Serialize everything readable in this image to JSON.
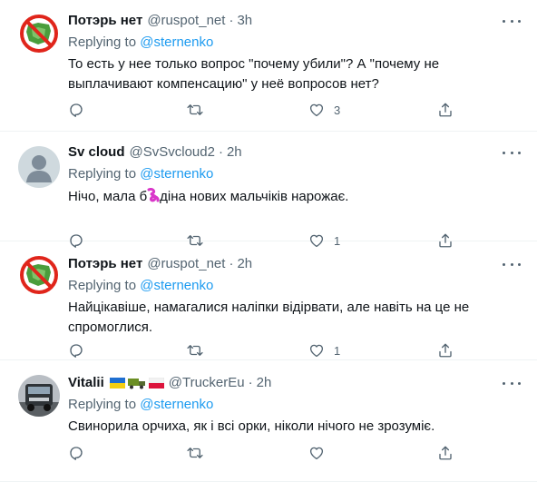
{
  "replying_prefix": "Replying to ",
  "colors": {
    "accent": "#1d9bf0",
    "muted": "#536471",
    "text": "#0f1419"
  },
  "tweets": [
    {
      "name": "Потэрь нет",
      "handle": "@ruspot_net",
      "dot": "·",
      "time": "3h",
      "replying_to": "@sternenko",
      "text": "То есть у нее только вопрос \"почему убили\"? А \"почему не выплачивают компенсацию\" у неё вопросов нет?",
      "likes": "3",
      "avatar_icon": "crossed-out-sign-avatar"
    },
    {
      "name": "Sv cloud",
      "handle": "@SvSvcloud2",
      "dot": "·",
      "time": "2h",
      "replying_to": "@sternenko",
      "text_before": "Нічо, мала б",
      "text_after": "діна нових мальчіків нарожає.",
      "likes": "1",
      "avatar_icon": "default-person-avatar"
    },
    {
      "name": "Потэрь нет",
      "handle": "@ruspot_net",
      "dot": "·",
      "time": "2h",
      "replying_to": "@sternenko",
      "text": "Найцікавіше, намагалися наліпки відірвати, але навіть на це не спромоглися.",
      "likes": "1",
      "avatar_icon": "crossed-out-sign-avatar"
    },
    {
      "name": "Vitalii",
      "handle": "@TruckerEu",
      "dot": "·",
      "time": "2h",
      "replying_to": "@sternenko",
      "text": "Свинорила орчиха, як і всі орки, ніколи нічого не зрозуміє.",
      "likes": "",
      "avatar_icon": "truck-photo-avatar",
      "flags": [
        "ukraine-flag",
        "truck-emoji",
        "poland-flag"
      ]
    }
  ]
}
